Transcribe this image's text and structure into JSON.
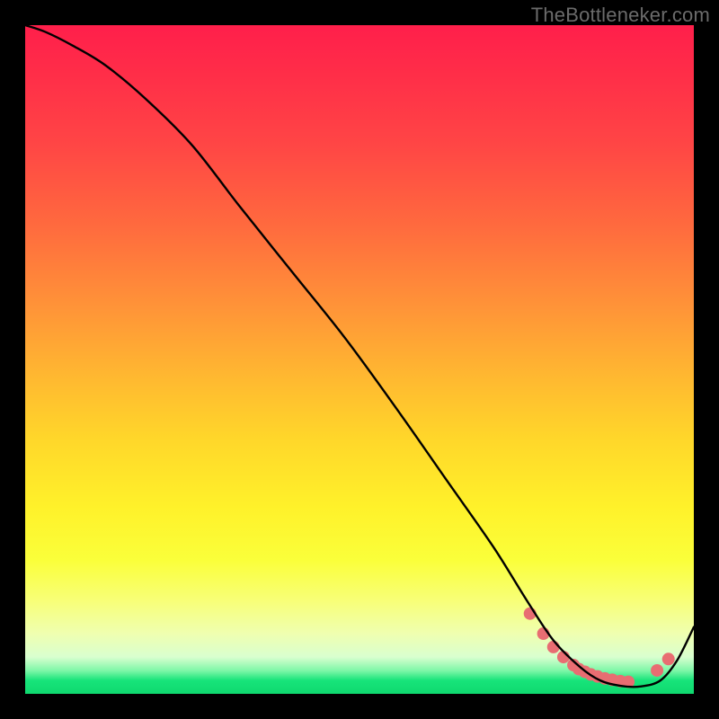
{
  "watermark": "TheBottleneker.com",
  "chart_data": {
    "type": "line",
    "title": "",
    "xlabel": "",
    "ylabel": "",
    "xlim": [
      0,
      100
    ],
    "ylim": [
      0,
      100
    ],
    "grid": false,
    "legend": false,
    "series": [
      {
        "name": "curve",
        "color": "#000000",
        "x": [
          0,
          3,
          7,
          12,
          18,
          25,
          32,
          40,
          48,
          56,
          63,
          70,
          75,
          79,
          83,
          86,
          89,
          92,
          95,
          97.5,
          100
        ],
        "y": [
          100,
          99,
          97,
          94,
          89,
          82,
          73,
          63,
          53,
          42,
          32,
          22,
          14,
          8,
          4,
          2,
          1.2,
          1.1,
          2,
          5,
          10
        ]
      }
    ],
    "markers": {
      "name": "dots",
      "color": "#e86d72",
      "radius_px": 7,
      "x": [
        75.5,
        77.5,
        79.0,
        80.5,
        82.0,
        82.8,
        83.7,
        84.6,
        85.6,
        86.7,
        87.8,
        89.0,
        90.2,
        94.5,
        96.2
      ],
      "y": [
        12.0,
        9.0,
        7.0,
        5.5,
        4.3,
        3.7,
        3.3,
        2.9,
        2.6,
        2.3,
        2.1,
        1.9,
        1.8,
        3.5,
        5.2
      ]
    },
    "background_gradient": {
      "top": "#ff1f4b",
      "mid": "#fff12a",
      "bottom": "#0fd96f"
    }
  }
}
